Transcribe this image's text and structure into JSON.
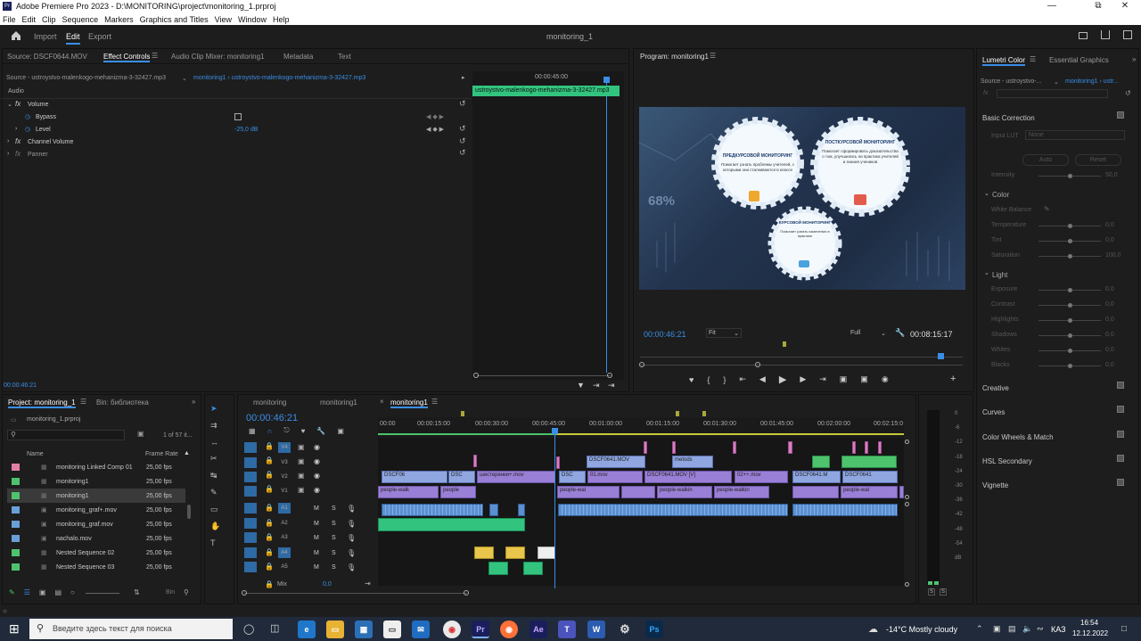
{
  "window": {
    "title": "Adobe Premiere Pro 2023 - D:\\MONITORING\\project\\monitoring_1.prproj"
  },
  "menu": [
    "File",
    "Edit",
    "Clip",
    "Sequence",
    "Markers",
    "Graphics and Titles",
    "View",
    "Window",
    "Help"
  ],
  "workspace": {
    "tabs": [
      "Import",
      "Edit",
      "Export"
    ],
    "active": "Edit",
    "project_title": "monitoring_1"
  },
  "source_panel": {
    "tabs": [
      "Source: DSCF0644.MOV",
      "Effect Controls",
      "Audio Clip Mixer: monitoring1",
      "Metadata",
      "Text"
    ],
    "active": "Effect Controls",
    "source_clip": "Source - ustroystvo-malenkogo-mehanizma-3-32427.mp3",
    "seq_clip": "monitoring1 › ustroystvo-malenkogo-mehanizma-3-32427.mp3",
    "section": "Audio",
    "props": [
      {
        "name": "Volume"
      },
      {
        "name": "Bypass"
      },
      {
        "name": "Level",
        "value": "-25,0 dB"
      },
      {
        "name": "Channel Volume"
      },
      {
        "name": "Panner"
      }
    ],
    "mini_time": "00:00:45:00",
    "mini_clip": "ustroystvo-malenkogo-mehanizma-3-32427.mp3",
    "timecode": "00:00:46:21"
  },
  "program": {
    "title": "Program: monitoring1",
    "timecode": "00:00:46:21",
    "fit": "Fit",
    "quality": "Full",
    "duration": "00:08:15:17",
    "gears": [
      {
        "title": "ПРЕДКУРСОВОЙ МОНИТОРИНГ",
        "text": "Помогает узнать проблемы учителей, с которыми они сталкиваются в классе"
      },
      {
        "title": "ПОСТКУРСОВОЙ МОНИТОРИНГ",
        "text": "Помогает сформировать доказательства о том, улучшились ли практика учителей и знания учеников"
      },
      {
        "title": "КУРСОВОЙ МОНИТОРИНГ",
        "text": "Помогает узнать изменения в практике"
      }
    ],
    "stat": "68%"
  },
  "lumetri": {
    "tabs": [
      "Lumetri Color",
      "Essential Graphics"
    ],
    "source": "Source - ustroystvo-...",
    "seq": "monitoring1 › ustr...",
    "basic": "Basic Correction",
    "input_lut": "Input LUT",
    "lut_val": "None",
    "auto": "Auto",
    "reset": "Reset",
    "intensity": {
      "label": "Intensity",
      "value": "50,0"
    },
    "color_h": "Color",
    "white_balance": "White Balance",
    "color_rows": [
      {
        "label": "Temperature",
        "value": "0,0"
      },
      {
        "label": "Tint",
        "value": "0,0"
      },
      {
        "label": "Saturation",
        "value": "100,0"
      }
    ],
    "light_h": "Light",
    "light_rows": [
      {
        "label": "Exposure",
        "value": "0,0"
      },
      {
        "label": "Contrast",
        "value": "0,0"
      },
      {
        "label": "Highlights",
        "value": "0,0"
      },
      {
        "label": "Shadows",
        "value": "0,0"
      },
      {
        "label": "Whites",
        "value": "0,0"
      },
      {
        "label": "Blacks",
        "value": "0,0"
      }
    ],
    "sections": [
      "Creative",
      "Curves",
      "Color Wheels & Match",
      "HSL Secondary",
      "Vignette"
    ]
  },
  "project": {
    "tabs": [
      "Project: monitoring_1",
      "Bin: библиотека"
    ],
    "file": "monitoring_1.prproj",
    "count": "1 of 57 it...",
    "col_name": "Name",
    "col_rate": "Frame Rate",
    "items": [
      {
        "name": "monitoring Linked Comp 01",
        "rate": "25,00 fps",
        "color": "#e27fa5"
      },
      {
        "name": "monitoring1",
        "rate": "25,00 fps",
        "color": "#4ec36e"
      },
      {
        "name": "monitoring1",
        "rate": "25,00 fps",
        "color": "#4ec36e"
      },
      {
        "name": "monitoring_graf+.mov",
        "rate": "25,00 fps",
        "color": "#6aa0d8"
      },
      {
        "name": "monitoring_graf.mov",
        "rate": "25,00 fps",
        "color": "#6aa0d8"
      },
      {
        "name": "nachalo.mov",
        "rate": "25,00 fps",
        "color": "#6aa0d8"
      },
      {
        "name": "Nested Sequence 02",
        "rate": "25,00 fps",
        "color": "#4ec36e"
      },
      {
        "name": "Nested Sequence 03",
        "rate": "25,00 fps",
        "color": "#4ec36e"
      }
    ]
  },
  "timeline": {
    "tabs": [
      "monitoring",
      "monitoring1",
      "monitoring1"
    ],
    "timecode": "00:00:46:21",
    "ruler": [
      "00:00",
      "00:00:15:00",
      "00:00:30:00",
      "00:00:45:00",
      "00:01:00:00",
      "00:01:15:00",
      "00:01:30:00",
      "00:01:45:00",
      "00:02:00:00",
      "00:02:15:0"
    ],
    "tracks": [
      "V4",
      "V3",
      "V2",
      "V1",
      "A1",
      "A2",
      "A3",
      "A4",
      "A5"
    ],
    "mix": "Mix",
    "mix_val": "0,0",
    "clip_labels": [
      "people-walk",
      "people",
      "DSCF06",
      "DSC",
      "шестеренки+.mov",
      "DSC",
      "01.mov",
      "DSCF0641.MOV",
      "metods",
      "DSCF0641.MOV [V]",
      "02++.mov",
      "DSCF0641.M",
      "DSCF0641",
      "people-wal",
      "people-walkin",
      "people-walkin",
      "people-wal"
    ]
  },
  "meter": {
    "scale": [
      "0",
      "-6",
      "-12",
      "-18",
      "-24",
      "-30",
      "-36",
      "-42",
      "-48",
      "-54",
      "dB"
    ],
    "solo": [
      "S",
      "S"
    ]
  },
  "taskbar": {
    "search": "Введите здесь текст для поиска",
    "weather": "-14°C  Mostly cloudy",
    "lang": "КАЗ",
    "time": "16:54",
    "date": "12.12.2022"
  }
}
